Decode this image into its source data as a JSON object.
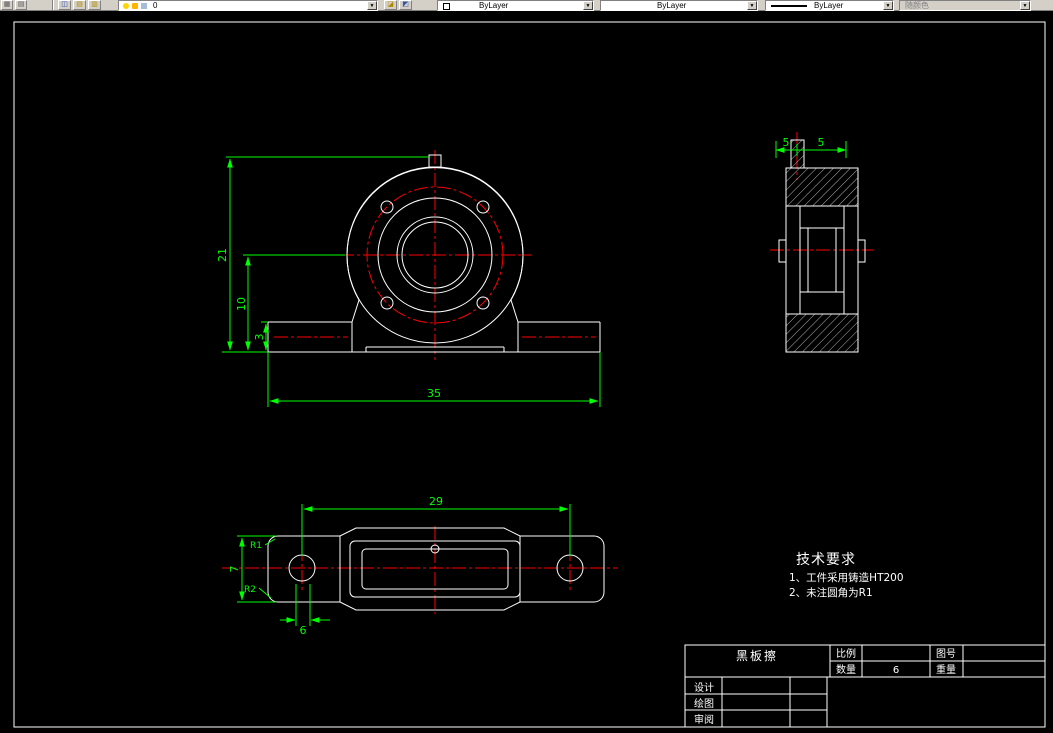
{
  "toolbar": {
    "layer_combo": {
      "value": "0"
    },
    "color_combo": {
      "value": "ByLayer"
    },
    "linetype_combo": {
      "value": "ByLayer"
    },
    "lineweight_combo": {
      "value": "ByLayer"
    },
    "plot_style_combo": {
      "value": "随颜色"
    }
  },
  "drawing": {
    "colors": {
      "geometry": "#ffffff",
      "centerline": "#ff0000",
      "dimension": "#00ff00"
    },
    "front_view": {
      "dim_total_height": "21",
      "dim_center_height": "10",
      "dim_base_height": "3",
      "dim_base_width": "35"
    },
    "side_view": {
      "dim_width_left": "5",
      "dim_width_right": "5"
    },
    "bottom_view": {
      "dim_hole_spacing": "29",
      "dim_plate_depth": "7",
      "dim_fillet_outer": "R1",
      "dim_fillet_inner": "R2",
      "dim_hole_diameter": "6"
    },
    "tech_requirements": {
      "title": "技术要求",
      "items": [
        "1、工件采用铸造HT200",
        "2、未注圆角为R1"
      ]
    },
    "title_block": {
      "part_name": "黑板擦",
      "scale_label": "比例",
      "drawing_no_label": "图号",
      "quantity_label": "数量",
      "quantity_value": "6",
      "weight_label": "重量",
      "design_label": "设计",
      "draft_label": "绘图",
      "review_label": "审阅"
    }
  }
}
